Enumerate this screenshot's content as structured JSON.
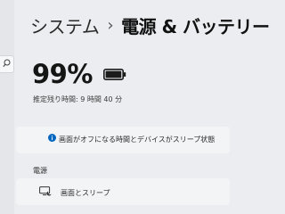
{
  "breadcrumb": {
    "parent": "システム",
    "separator": "›",
    "current": "電源 & バッテリー"
  },
  "battery": {
    "percent_label": "99%",
    "level": 0.99,
    "remaining_label": "推定残り時間: 9 時間 40 分"
  },
  "info": {
    "icon": "info-icon",
    "text": "画面がオフになる時間とデバイスがスリープ状態になる時間が異な"
  },
  "power_section": {
    "heading": "電源",
    "screen_sleep": {
      "icon": "monitor-icon",
      "label": "画面とスリープ"
    }
  },
  "colors": {
    "background": "#ebedf0",
    "card": "#f3f4f6",
    "accent": "#0067c0",
    "text": "#1b1b1b"
  }
}
